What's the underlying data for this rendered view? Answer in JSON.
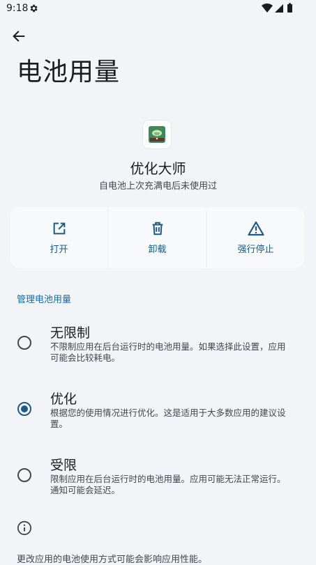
{
  "status_bar": {
    "time": "9:18"
  },
  "header": {
    "title": "电池用量"
  },
  "app": {
    "name": "优化大师",
    "subtitle": "自电池上次充满电后未使用过"
  },
  "actions": [
    {
      "label": "打开",
      "icon": "open-external-icon"
    },
    {
      "label": "卸载",
      "icon": "trash-icon"
    },
    {
      "label": "强行停止",
      "icon": "warning-icon"
    }
  ],
  "section": {
    "title": "管理电池用量"
  },
  "options": [
    {
      "title": "无限制",
      "desc": "不限制应用在后台运行时的电池用量。如果选择此设置，应用可能会比较耗电。",
      "selected": false
    },
    {
      "title": "优化",
      "desc": "根据您的使用情况进行优化。这是适用于大多数应用的建议设置。",
      "selected": true
    },
    {
      "title": "受限",
      "desc": "限制应用在后台运行时的电池用量。应用可能无法正常运行。通知可能会延迟。",
      "selected": false
    }
  ],
  "footer": {
    "text": "更改应用的电池使用方式可能会影响应用性能。"
  },
  "colors": {
    "background": "#f2f4f7",
    "accent": "#1d5b85",
    "section_header": "#1d6aa0",
    "text_primary": "#1b1c1e",
    "text_secondary": "#42474d"
  }
}
